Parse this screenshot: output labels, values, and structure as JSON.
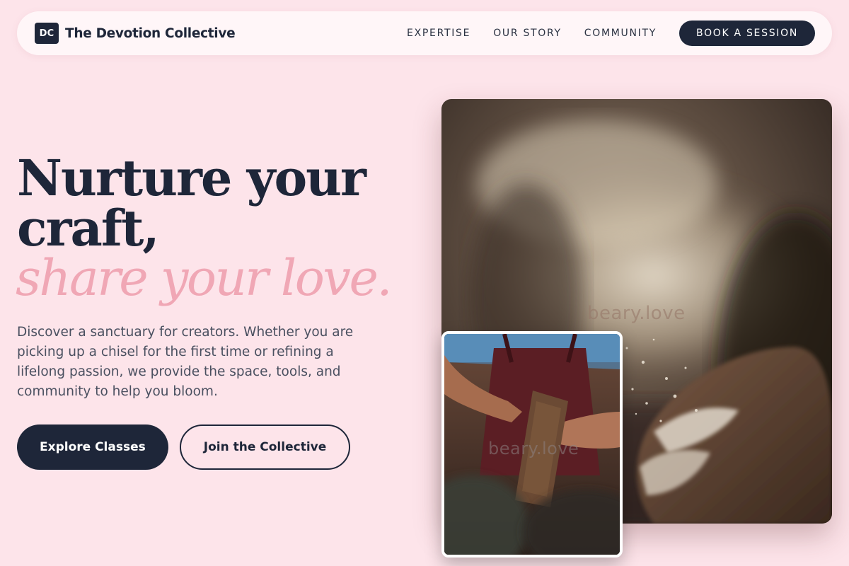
{
  "nav": {
    "brand_mark": "DC",
    "brand_name": "The Devotion Collective",
    "links": [
      "EXPERTISE",
      "OUR STORY",
      "COMMUNITY"
    ],
    "cta": "BOOK A SESSION"
  },
  "hero": {
    "title_line1": "Nurture your",
    "title_line2": "craft,",
    "title_accent": "share your love.",
    "description": "Discover a sanctuary for creators. Whether you are picking up a chisel for the first time or refining a lifelong passion, we provide the space, tools, and community to help you bloom.",
    "primary_button": "Explore Classes",
    "secondary_button": "Join the Collective"
  },
  "images": {
    "main_watermark": "beary.love",
    "small_watermark": "beary.love"
  },
  "colors": {
    "background": "#fde4ea",
    "navy": "#1e2639",
    "accent_pink": "#f0a7b5",
    "nav_background": "#fff6f8"
  }
}
